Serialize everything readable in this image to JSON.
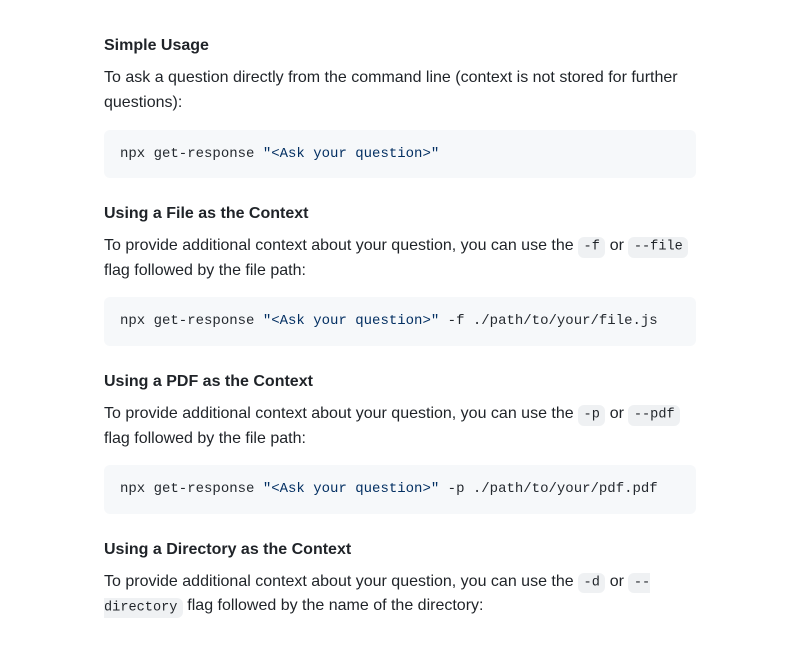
{
  "sections": [
    {
      "heading": "Simple Usage",
      "paragraph_parts": [
        {
          "text": "To ask a question directly from the command line (context is not stored for further questions):"
        }
      ],
      "code_prefix": "npx get-response ",
      "code_string": "\"<Ask your question>\"",
      "code_suffix": ""
    },
    {
      "heading": "Using a File as the Context",
      "paragraph_parts": [
        {
          "text": "To provide additional context about your question, you can use the "
        },
        {
          "code": "-f"
        },
        {
          "text": " or "
        },
        {
          "code": "--file"
        },
        {
          "text": " flag followed by the file path:"
        }
      ],
      "code_prefix": "npx get-response ",
      "code_string": "\"<Ask your question>\"",
      "code_suffix": " -f ./path/to/your/file.js"
    },
    {
      "heading": "Using a PDF as the Context",
      "paragraph_parts": [
        {
          "text": "To provide additional context about your question, you can use the "
        },
        {
          "code": "-p"
        },
        {
          "text": " or "
        },
        {
          "code": "--pdf"
        },
        {
          "text": " flag followed by the file path:"
        }
      ],
      "code_prefix": "npx get-response ",
      "code_string": "\"<Ask your question>\"",
      "code_suffix": " -p ./path/to/your/pdf.pdf"
    },
    {
      "heading": "Using a Directory as the Context",
      "paragraph_parts": [
        {
          "text": "To provide additional context about your question, you can use the "
        },
        {
          "code": "-d"
        },
        {
          "text": " or "
        },
        {
          "code": "--directory"
        },
        {
          "text": " flag followed by the name of the directory:"
        }
      ],
      "code_prefix": "",
      "code_string": "",
      "code_suffix": ""
    }
  ]
}
